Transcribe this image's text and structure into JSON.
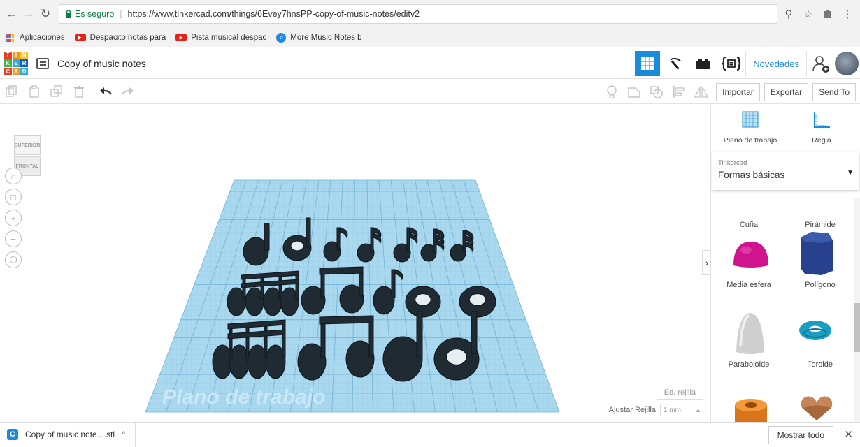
{
  "browser": {
    "secure_label": "Es seguro",
    "url": "https://www.tinkercad.com/things/6Evey7hnsPP-copy-of-music-notes/editv2",
    "bookmarks": [
      {
        "label": "Aplicaciones",
        "icon": "apps-grid-icon"
      },
      {
        "label": "Despacito notas para",
        "icon": "youtube-icon"
      },
      {
        "label": "Pista musical despac",
        "icon": "youtube-icon"
      },
      {
        "label": "More Music Notes b",
        "icon": "music-notes-site-icon"
      }
    ]
  },
  "app": {
    "logo_letters": [
      "T",
      "I",
      "N",
      "K",
      "E",
      "R",
      "C",
      "A",
      "D"
    ],
    "logo_colors": [
      "#e83d25",
      "#f39a1e",
      "#f7c31d",
      "#3ab54a",
      "#2ca9e1",
      "#1a5fb4",
      "#e83d25",
      "#f39a1e",
      "#2ca9e1"
    ],
    "doc_title": "Copy of music notes",
    "novedades": "Novedades",
    "accent": "#1a8bd8"
  },
  "toolbar": {
    "import": "Importar",
    "export": "Exportar",
    "sendto": "Send To"
  },
  "workspace": {
    "viewcube_top": "SUPERIOR",
    "viewcube_front": "FRONTAL",
    "plane_label": "Plano de trabajo",
    "edit_grid": "Ed. rejilla",
    "snap_label": "Ajustar Rejilla",
    "snap_value": "1 mm",
    "plane_color": "#a9d8ef",
    "notes_color": "#1f2a33"
  },
  "panel": {
    "workplane": "Plano de trabajo",
    "ruler": "Regla",
    "category": "Tinkercad",
    "shapes_set": "Formas básicas",
    "shapes": [
      {
        "label": "Cuña"
      },
      {
        "label": "Pirámide"
      },
      {
        "label": "Media esfera"
      },
      {
        "label": "Polígono"
      },
      {
        "label": "Paraboloide"
      },
      {
        "label": "Toroide"
      }
    ]
  },
  "downloads": {
    "file": "Copy of music note....stl",
    "show_all": "Mostrar todo"
  }
}
